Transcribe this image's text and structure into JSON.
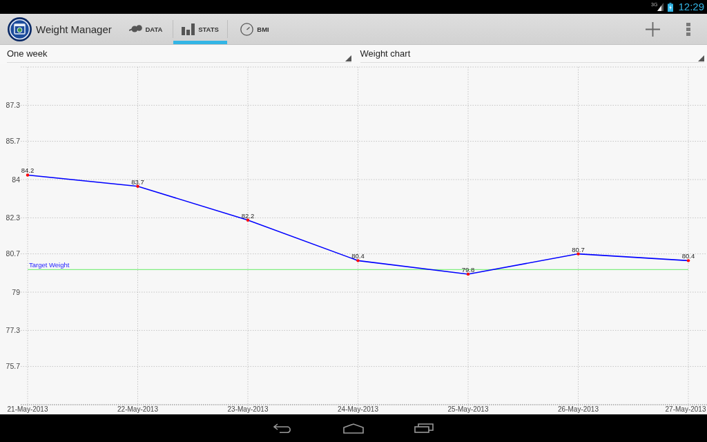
{
  "status_bar": {
    "network_type": "3G",
    "time": "12:29"
  },
  "action_bar": {
    "title": "Weight Manager",
    "tabs": [
      {
        "label": "DATA",
        "selected": false
      },
      {
        "label": "STATS",
        "selected": true
      },
      {
        "label": "BMI",
        "selected": false
      }
    ]
  },
  "selectors": [
    {
      "value": "One week"
    },
    {
      "value": "Weight chart"
    }
  ],
  "chart": {
    "chart_data": {
      "type": "line",
      "categories": [
        "21-May-2013",
        "22-May-2013",
        "23-May-2013",
        "24-May-2013",
        "25-May-2013",
        "26-May-2013",
        "27-May-2013"
      ],
      "series": [
        {
          "color": "#0000ff",
          "values": [
            84.2,
            83.7,
            82.2,
            80.4,
            79.8,
            80.7,
            80.4
          ]
        }
      ],
      "ylim": [
        74,
        89
      ],
      "yticks": [
        75.7,
        77.3,
        79,
        80.7,
        82.3,
        84,
        85.7,
        87.3
      ],
      "grid": true,
      "data_labels": true,
      "ref_lines": [
        {
          "axis": "y",
          "value": 80,
          "label": "Target Weight",
          "color": "#80ee80"
        }
      ]
    }
  }
}
